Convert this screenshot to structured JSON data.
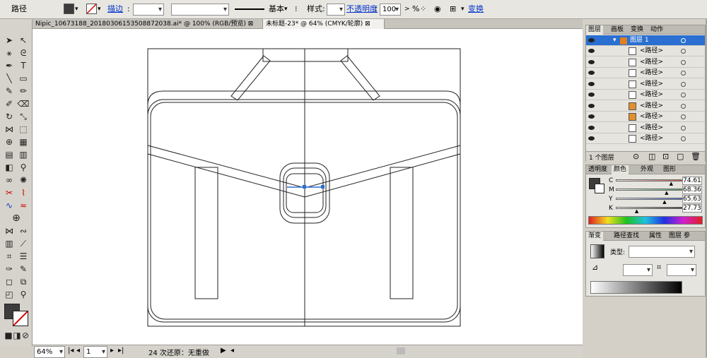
{
  "control_bar": {
    "object_type": "路径",
    "stroke_label": "描边",
    "stroke_value": "",
    "profile_value": "",
    "brush_label": "基本",
    "style_label": "样式",
    "opacity_label": "不透明度",
    "opacity_value": "100",
    "opacity_unit": "%",
    "transform_label": "变换"
  },
  "doc_tabs": [
    {
      "label": "Nipic_10673188_20180306153508872038.ai* @ 100% (RGB/预览)",
      "close": "⊠"
    },
    {
      "label": "未标题-23* @ 64% (CMYK/轮廓)",
      "close": "⊠"
    }
  ],
  "status_bar": {
    "zoom": "64%",
    "page": "1",
    "undo_text": "24 次还原：无重做"
  },
  "layers_panel": {
    "tabs": [
      "图层",
      "画板",
      "变换",
      "动作"
    ],
    "layer_name": "图层 1",
    "rows": [
      "<路径>",
      "<路径>",
      "<路径>",
      "<路径>",
      "<路径>",
      "<路径>",
      "<路径>",
      "<路径>",
      "<路径>"
    ],
    "footer": "1 个图层"
  },
  "color_panel": {
    "tabs": [
      "透明度",
      "颜色",
      "外观",
      "图形"
    ],
    "channels": [
      {
        "label": "C",
        "value": "74.61",
        "color": "#c84a3a"
      },
      {
        "label": "M",
        "value": "68.36",
        "color": "#3a9a4a"
      },
      {
        "label": "Y",
        "value": "65.63",
        "color": "#3858c8"
      },
      {
        "label": "K",
        "value": "27.73",
        "color": "#222222"
      }
    ]
  },
  "gradient_panel": {
    "tabs": [
      "渐变",
      "路径查找",
      "属性",
      "图层 参"
    ],
    "type_label": "类型:"
  },
  "colors": {
    "selection": "#2a6fd1",
    "fill_swatch": "#3c3c3c"
  }
}
